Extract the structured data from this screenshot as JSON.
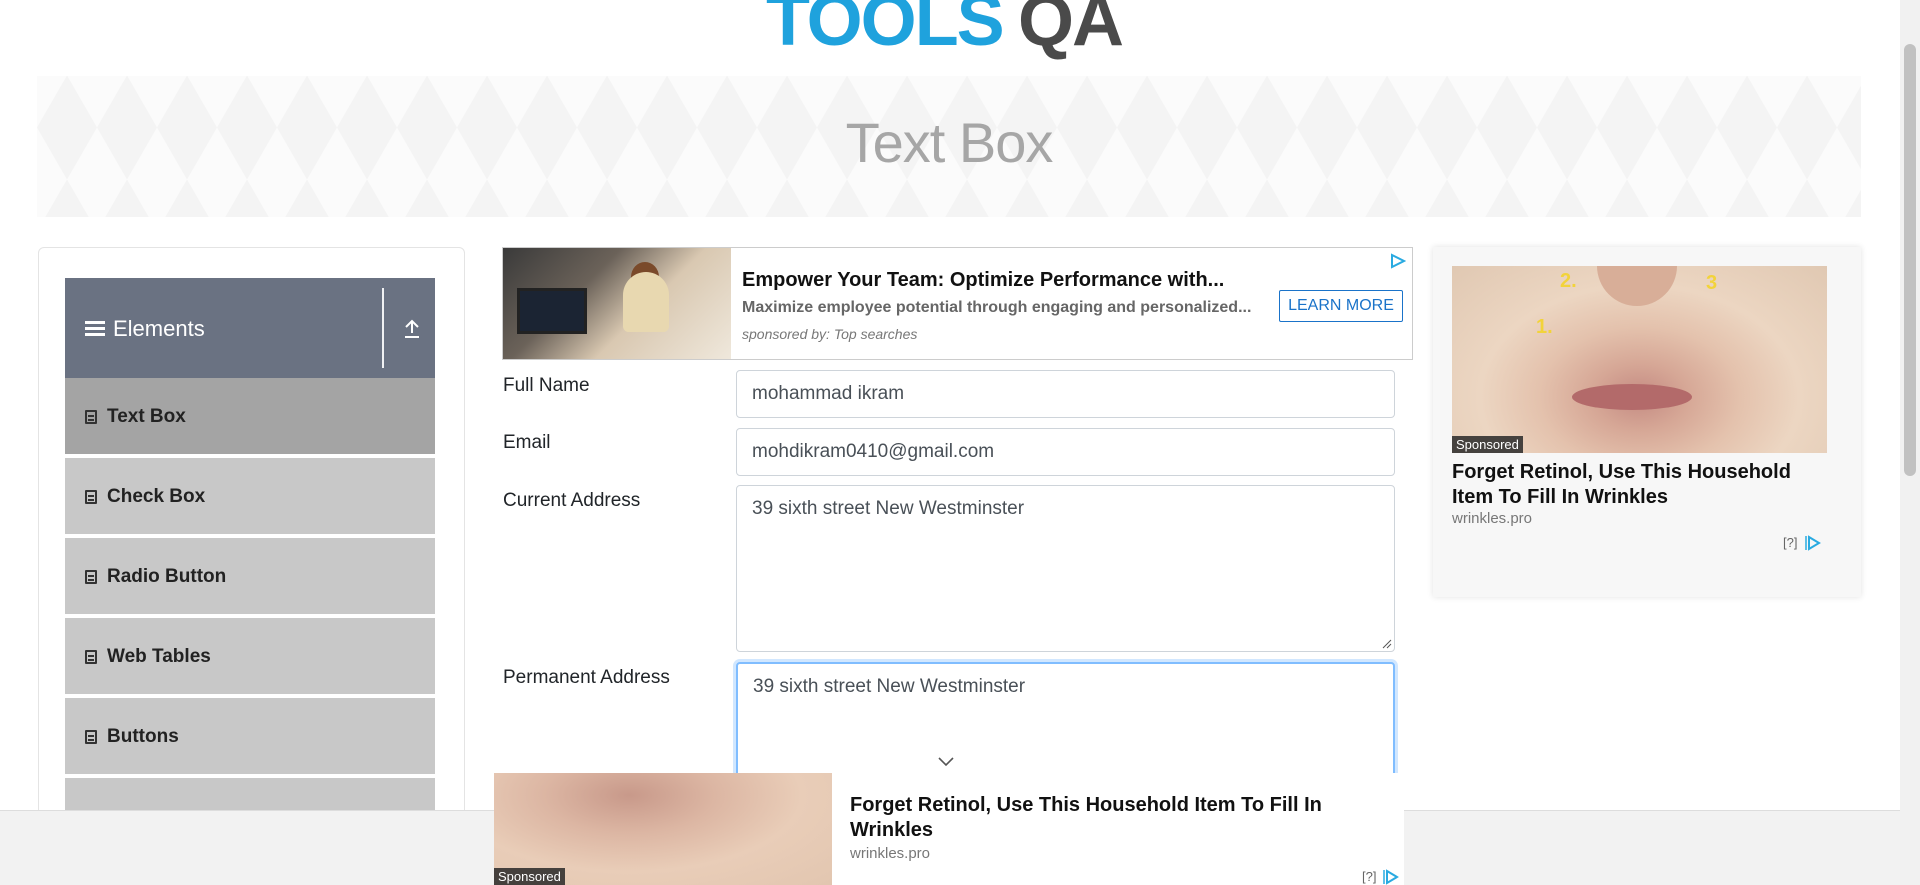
{
  "header": {
    "logo_text": "TOOLS",
    "logo_qa": "QA"
  },
  "banner": {
    "title": "Text Box"
  },
  "sidebar": {
    "group_title": "Elements",
    "items": [
      {
        "label": "Text Box",
        "active": true
      },
      {
        "label": "Check Box",
        "active": false
      },
      {
        "label": "Radio Button",
        "active": false
      },
      {
        "label": "Web Tables",
        "active": false
      },
      {
        "label": "Buttons",
        "active": false
      }
    ]
  },
  "ad_top": {
    "headline": "Empower Your Team: Optimize Performance with...",
    "subline": "Maximize employee potential through engaging and personalized...",
    "sponsor": "sponsored by: Top searches",
    "cta": "LEARN MORE"
  },
  "form": {
    "full_name_label": "Full Name",
    "full_name_value": "mohammad ikram",
    "email_label": "Email",
    "email_value": "mohdikram0410@gmail.com",
    "current_address_label": "Current Address",
    "current_address_value": "39 sixth street New Westminster",
    "permanent_address_label": "Permanent Address",
    "permanent_address_value": "39 sixth street New Westminster"
  },
  "ad_right": {
    "sponsored": "Sponsored",
    "title": "Forget Retinol, Use This Household Item To Fill In Wrinkles",
    "domain": "wrinkles.pro",
    "help": "[?]",
    "labels": [
      "1.",
      "2.",
      "3"
    ]
  },
  "ad_bottom": {
    "sponsored": "Sponsored",
    "title": "Forget Retinol, Use This Household Item To Fill In Wrinkles",
    "domain": "wrinkles.pro",
    "help": "[?]"
  },
  "colors": {
    "accent": "#1fa2dd",
    "nav_header": "#6a7282",
    "nav_item": "#c8c8c8",
    "nav_item_active": "#a4a4a4",
    "focus_border": "#80bdff",
    "ad_cta": "#1a73c9"
  },
  "icons": {
    "menu": "hamburger-icon",
    "collapse": "upload-arrow-icon",
    "nav_item": "html5-icon",
    "adchoices": "adchoices-icon",
    "chevron": "chevron-down-icon"
  }
}
